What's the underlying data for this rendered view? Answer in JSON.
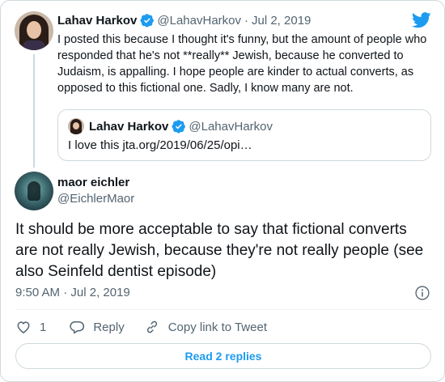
{
  "parent": {
    "name": "Lahav Harkov",
    "handle": "@LahavHarkov",
    "separator": "·",
    "date": "Jul 2, 2019",
    "text": "I posted this because I thought it's funny, but the amount of people who responded that he's not **really** Jewish, because he converted to Judaism, is appalling. I hope people are kinder to actual converts, as opposed to this fictional one. Sadly, I know many are not."
  },
  "quote": {
    "name": "Lahav Harkov",
    "handle": "@LahavHarkov",
    "text": "I love this jta.org/2019/06/25/opi…"
  },
  "main": {
    "name": "maor eichler",
    "handle": "@EichlerMaor",
    "text": "It should be more acceptable to say that fictional converts are not really Jewish, because they're not really people (see also Seinfeld dentist episode)",
    "time": "9:50 AM",
    "separator": "·",
    "date": "Jul 2, 2019"
  },
  "actions": {
    "like_count": "1",
    "reply_label": "Reply",
    "copy_link_label": "Copy link to Tweet"
  },
  "read_replies_label": "Read 2 replies",
  "icons": {
    "verified": "verified-badge-icon",
    "bird": "twitter-bird-icon",
    "info": "info-icon",
    "like": "heart-icon",
    "reply": "speech-bubble-icon",
    "link": "link-icon"
  },
  "colors": {
    "accent": "#1d9bf0",
    "text": "#0f1419",
    "secondary": "#536471",
    "border": "#cfd9de"
  }
}
